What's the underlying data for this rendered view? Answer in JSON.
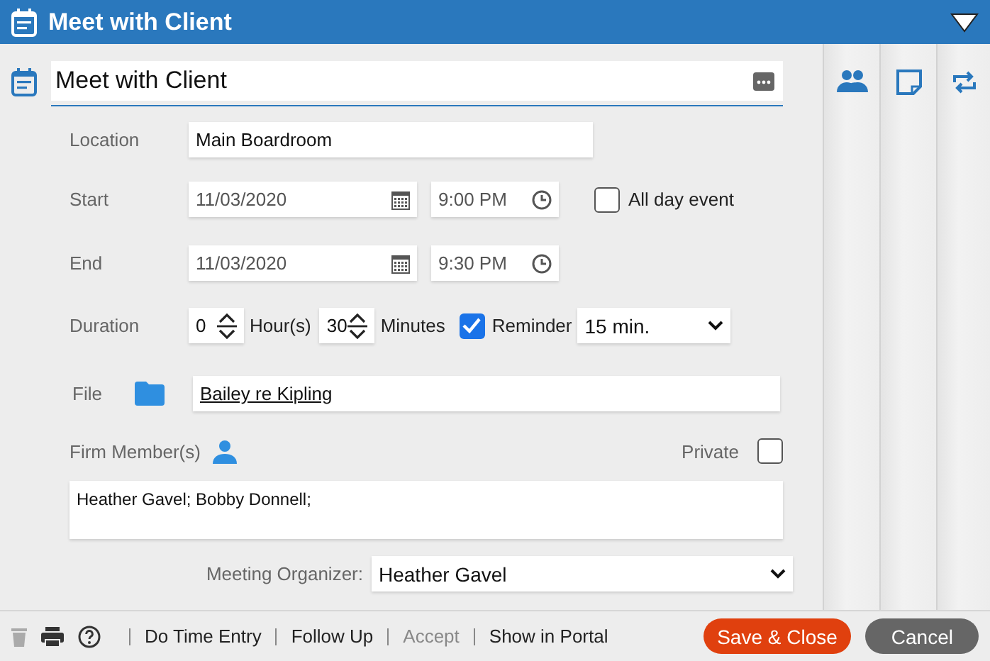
{
  "window": {
    "title": "Meet with Client"
  },
  "subject": {
    "value": "Meet with Client"
  },
  "location": {
    "label": "Location",
    "value": "Main Boardroom"
  },
  "start": {
    "label": "Start",
    "date": "11/03/2020",
    "time": "9:00 PM"
  },
  "all_day": {
    "label": "All day event",
    "checked": false
  },
  "end": {
    "label": "End",
    "date": "11/03/2020",
    "time": "9:30 PM"
  },
  "duration": {
    "label": "Duration",
    "hours": "0",
    "hours_unit": "Hour(s)",
    "minutes": "30",
    "minutes_unit": "Minutes"
  },
  "reminder": {
    "label": "Reminder",
    "checked": true,
    "value": "15 min."
  },
  "file": {
    "label": "File",
    "value": "Bailey re Kipling"
  },
  "firm_members": {
    "label": "Firm Member(s)",
    "value": "Heather Gavel; Bobby Donnell;"
  },
  "private": {
    "label": "Private",
    "checked": false
  },
  "organizer": {
    "label": "Meeting Organizer:",
    "value": "Heather Gavel"
  },
  "side_tabs": [
    {
      "kind": "people",
      "selected": false
    },
    {
      "kind": "note",
      "selected": false
    },
    {
      "kind": "repeat",
      "selected": false
    }
  ],
  "footer": {
    "delete_disabled": true,
    "links": [
      {
        "label": "Do Time Entry",
        "disabled": false
      },
      {
        "label": "Follow Up",
        "disabled": false
      },
      {
        "label": "Accept",
        "disabled": true
      },
      {
        "label": "Show in Portal",
        "disabled": false
      }
    ],
    "buttons": [
      {
        "label": "Save & Close",
        "kind": "primary"
      },
      {
        "label": "Cancel",
        "kind": "secondary"
      }
    ]
  }
}
